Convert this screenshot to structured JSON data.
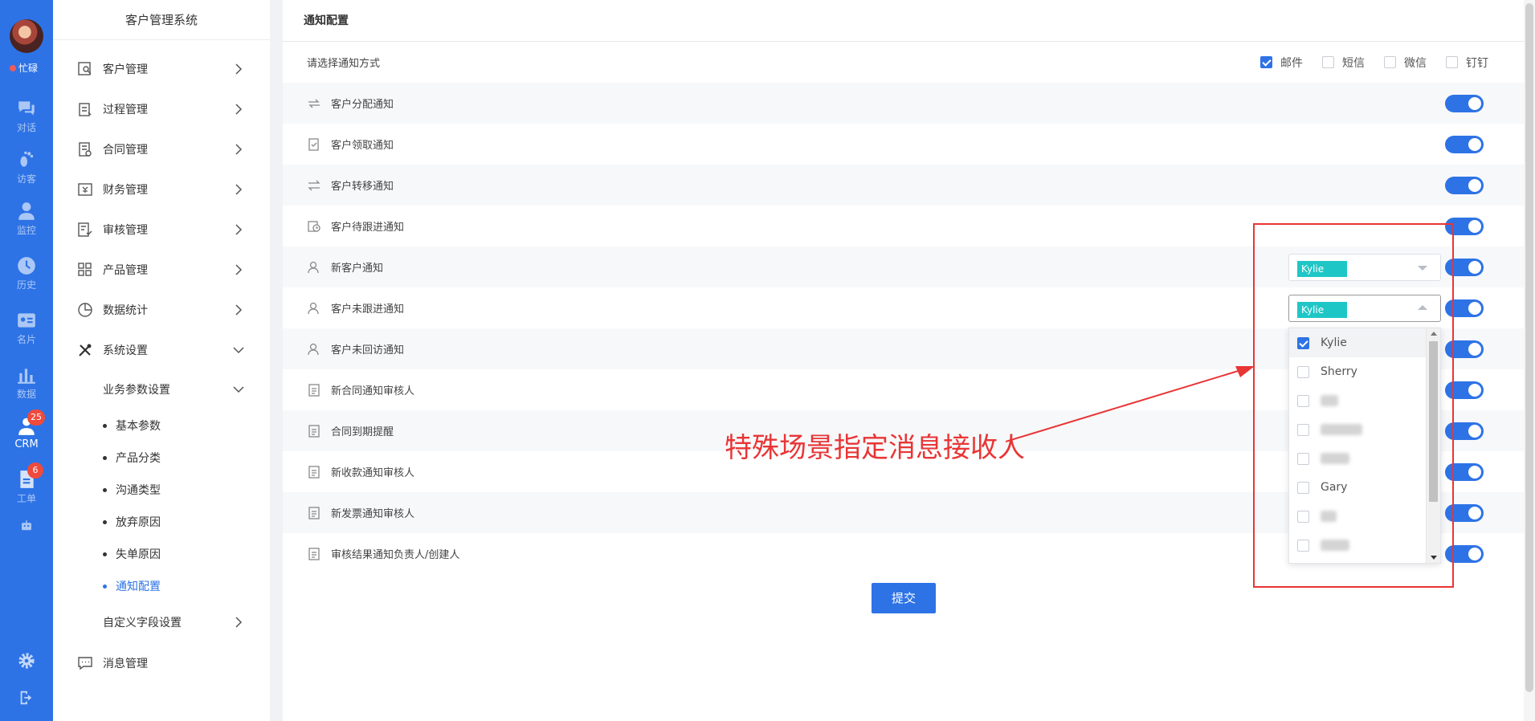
{
  "rail": {
    "status": "忙碌",
    "items": [
      {
        "label": "对话",
        "icon": "chat-icon"
      },
      {
        "label": "访客",
        "icon": "footprint-icon"
      },
      {
        "label": "监控",
        "icon": "monitor-icon"
      },
      {
        "label": "历史",
        "icon": "clock-icon"
      },
      {
        "label": "名片",
        "icon": "card-icon"
      },
      {
        "label": "数据",
        "icon": "bar-chart-icon"
      },
      {
        "label": "CRM",
        "icon": "crm-icon",
        "badge": "25"
      },
      {
        "label": "工单",
        "icon": "ticket-icon",
        "badge": "6"
      }
    ]
  },
  "sidebar": {
    "title": "客户管理系统",
    "menu": [
      {
        "label": "客户管理"
      },
      {
        "label": "过程管理"
      },
      {
        "label": "合同管理"
      },
      {
        "label": "财务管理"
      },
      {
        "label": "审核管理"
      },
      {
        "label": "产品管理"
      },
      {
        "label": "数据统计"
      },
      {
        "label": "系统设置"
      }
    ],
    "sub_group": "业务参数设置",
    "sub_items": [
      {
        "label": "基本参数"
      },
      {
        "label": "产品分类"
      },
      {
        "label": "沟通类型"
      },
      {
        "label": "放弃原因"
      },
      {
        "label": "失单原因"
      },
      {
        "label": "通知配置"
      }
    ],
    "custom_fields": "自定义字段设置",
    "messages": "消息管理"
  },
  "panel": {
    "title": "通知配置",
    "method_prompt": "请选择通知方式",
    "methods": [
      {
        "label": "邮件",
        "checked": true
      },
      {
        "label": "短信",
        "checked": false
      },
      {
        "label": "微信",
        "checked": false
      },
      {
        "label": "钉钉",
        "checked": false
      }
    ],
    "rows": [
      {
        "label": "客户分配通知",
        "enabled": true
      },
      {
        "label": "客户领取通知",
        "enabled": true
      },
      {
        "label": "客户转移通知",
        "enabled": true
      },
      {
        "label": "客户待跟进通知",
        "enabled": true
      },
      {
        "label": "新客户通知",
        "enabled": true,
        "recipient": "Kylie"
      },
      {
        "label": "客户未跟进通知",
        "enabled": true,
        "recipient": "Kylie"
      },
      {
        "label": "客户未回访通知",
        "enabled": true
      },
      {
        "label": "新合同通知审核人",
        "enabled": true
      },
      {
        "label": "合同到期提醒",
        "enabled": true
      },
      {
        "label": "新收款通知审核人",
        "enabled": true
      },
      {
        "label": "新发票通知审核人",
        "enabled": true
      },
      {
        "label": "审核结果通知负责人/创建人",
        "enabled": true
      }
    ],
    "dropdown_options": [
      {
        "label": "Kylie",
        "checked": true
      },
      {
        "label": "Sherry",
        "checked": false
      },
      {
        "label": "",
        "checked": false
      },
      {
        "label": "",
        "checked": false
      },
      {
        "label": "",
        "checked": false
      },
      {
        "label": "Gary",
        "checked": false
      },
      {
        "label": "",
        "checked": false
      },
      {
        "label": "",
        "checked": false
      }
    ],
    "submit": "提交"
  },
  "annotation": {
    "text": "特殊场景指定消息接收人",
    "color": "#e93535"
  },
  "colors": {
    "primary": "#2d73e6",
    "tag": "#1fc6c6"
  }
}
